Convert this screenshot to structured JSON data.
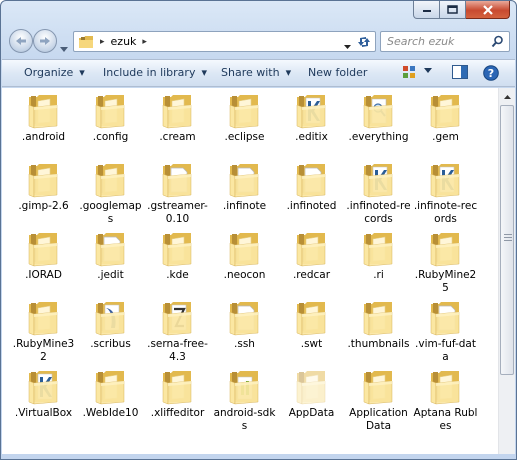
{
  "window": {
    "caption_buttons": [
      "minimize-icon",
      "maximize-icon",
      "close-icon"
    ]
  },
  "address_bar": {
    "path": "ezuk",
    "separator": "▸"
  },
  "search": {
    "placeholder": "Search ezuk"
  },
  "toolbar": {
    "organize": "Organize",
    "include_in_library": "Include in library",
    "share_with": "Share with",
    "new_folder": "New folder",
    "dropdown_arrow": "▾"
  },
  "colors": {
    "folder_light": "#fbe7a2",
    "folder_dark": "#e2b94e",
    "accent_blue": "#1e395b"
  },
  "folders": [
    {
      "name": ".android",
      "overlay": "plain"
    },
    {
      "name": ".config",
      "overlay": "plain"
    },
    {
      "name": ".cream",
      "overlay": "plain"
    },
    {
      "name": ".eclipse",
      "overlay": "plain"
    },
    {
      "name": ".editix",
      "overlay": "blue-k"
    },
    {
      "name": ".everything",
      "overlay": "doc-magnifier"
    },
    {
      "name": ".gem",
      "overlay": "plain"
    },
    {
      "name": ".gimp-2.6",
      "overlay": "plain"
    },
    {
      "name": ".googlemaps",
      "overlay": "plain"
    },
    {
      "name": ".gstreamer-0.10",
      "overlay": "white-doc"
    },
    {
      "name": ".infinote",
      "overlay": "white-doc"
    },
    {
      "name": ".infinoted",
      "overlay": "white-doc"
    },
    {
      "name": ".infinoted-records",
      "overlay": "blue-k"
    },
    {
      "name": ".infinote-records",
      "overlay": "blue-k"
    },
    {
      "name": ".IORAD",
      "overlay": "plain"
    },
    {
      "name": ".jedit",
      "overlay": "white-doc"
    },
    {
      "name": ".kde",
      "overlay": "plain"
    },
    {
      "name": ".neocon",
      "overlay": "plain"
    },
    {
      "name": ".redcar",
      "overlay": "plain"
    },
    {
      "name": ".ri",
      "overlay": "plain"
    },
    {
      "name": ".RubyMine25",
      "overlay": "plain"
    },
    {
      "name": ".RubyMine32",
      "overlay": "plain"
    },
    {
      "name": ".scribus",
      "overlay": "scribus"
    },
    {
      "name": ".serna-free-4.3",
      "overlay": "serna"
    },
    {
      "name": ".ssh",
      "overlay": "white-doc"
    },
    {
      "name": ".swt",
      "overlay": "plain"
    },
    {
      "name": ".thumbnails",
      "overlay": "plain"
    },
    {
      "name": ".vim-fuf-data",
      "overlay": "white-doc"
    },
    {
      "name": ".VirtualBox",
      "overlay": "blue-k"
    },
    {
      "name": ".WebIde10",
      "overlay": "plain"
    },
    {
      "name": ".xliffeditor",
      "overlay": "plain"
    },
    {
      "name": "android-sdks",
      "overlay": "green"
    },
    {
      "name": "AppData",
      "overlay": "hidden"
    },
    {
      "name": "Application Data",
      "overlay": "plain"
    },
    {
      "name": "Aptana Rubles",
      "overlay": "plain"
    }
  ]
}
